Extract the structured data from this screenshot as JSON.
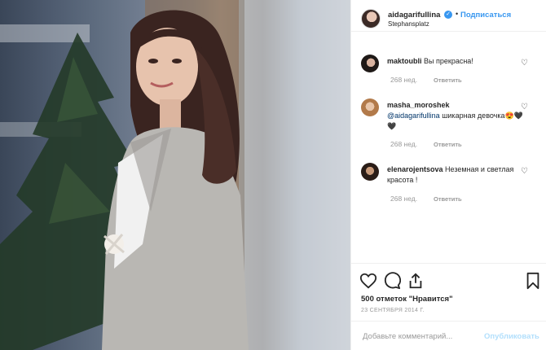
{
  "post": {
    "username": "aidagarifullina",
    "follow_label": "Подписаться",
    "dot": "•",
    "location": "Stephansplatz",
    "photo_description_icon": "portrait-photo"
  },
  "comments": [
    {
      "username": "maktoubli",
      "text": "Вы прекрасна!",
      "age": "268 нед.",
      "reply": "Ответить"
    },
    {
      "username": "masha_moroshek",
      "mention": "@aidagarifullina",
      "text": " шикарная девочка😍🖤🖤",
      "age": "268 нед.",
      "reply": "Ответить"
    },
    {
      "username": "elenarojentsova",
      "text": "Неземная и светлая красота !",
      "age": "268 нед.",
      "reply": "Ответить"
    }
  ],
  "likes": {
    "text": "500 отметок \"Нравится\""
  },
  "date": "23 СЕНТЯБРЯ 2014 Г.",
  "add_comment": {
    "placeholder": "Добавьте комментарий...",
    "publish_label": "Опубликовать"
  },
  "colors": {
    "accent": "#3897f0",
    "publish_disabled": "#b2dffc",
    "meta": "#999999"
  }
}
